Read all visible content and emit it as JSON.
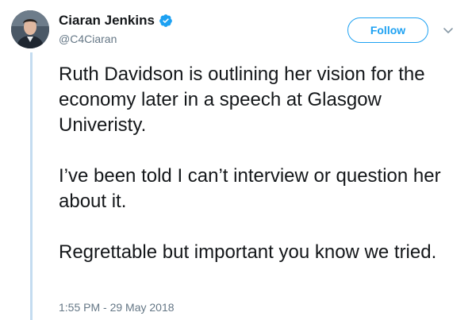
{
  "author": {
    "display_name": "Ciaran Jenkins",
    "handle": "@C4Ciaran",
    "verified_icon": "verified-badge-icon",
    "avatar_icon": "profile-photo"
  },
  "actions": {
    "follow_label": "Follow",
    "more_icon": "chevron-down-icon"
  },
  "tweet": {
    "paragraphs": [
      "Ruth Davidson is outlining her vision for the economy later in a speech at Glasgow Univeristy.",
      "I’ve been told I can’t interview or question her about it.",
      "Regrettable but important you know we tried."
    ],
    "timestamp": "1:55 PM - 29 May 2018"
  },
  "colors": {
    "accent": "#1da1f2",
    "text": "#14171a",
    "secondary_text": "#657786",
    "thread_line": "#c4dcf0"
  }
}
